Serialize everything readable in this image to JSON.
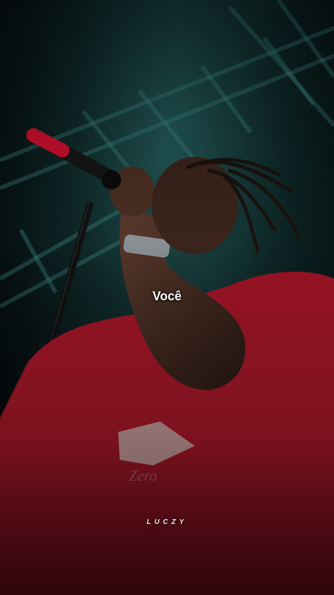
{
  "caption": {
    "text": "Você"
  },
  "watermark": {
    "text": "LUCZY"
  },
  "colors": {
    "background_teal": "#1d4a4a",
    "shirt_red": "#b0182a",
    "stage_dark": "#050c0d"
  }
}
